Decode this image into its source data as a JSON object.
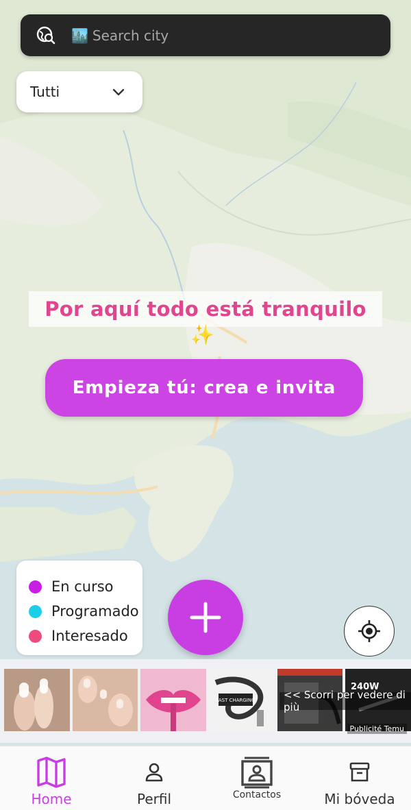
{
  "search": {
    "placeholder": "Search city",
    "globe_icon": "globe-search-icon",
    "city_emoji": "🏙️"
  },
  "filter": {
    "selected": "Tutti",
    "icon": "chevron-down-icon"
  },
  "empty_state": {
    "title": "Por aquí todo está tranquilo",
    "emoji": "✨"
  },
  "cta": {
    "label": "Empieza tú: crea e invita"
  },
  "legend": {
    "items": [
      {
        "label": "En curso",
        "color": "#c81fe6"
      },
      {
        "label": "Programado",
        "color": "#1ccfe8"
      },
      {
        "label": "Interesado",
        "color": "#ee4b7d"
      }
    ]
  },
  "fab": {
    "icon": "plus-icon"
  },
  "locate": {
    "icon": "crosshair-icon"
  },
  "ad": {
    "scroll_hint": "<< Scorri per vedere di più",
    "footer": "Publicité Temu",
    "thumb_texts": [
      "FAST CHARGING",
      "240W"
    ]
  },
  "nav": {
    "items": [
      {
        "label": "Home",
        "icon": "map-icon",
        "active": true
      },
      {
        "label": "Perfil",
        "icon": "person-icon",
        "active": false
      },
      {
        "label": "Contactos",
        "icon": "contacts-icon",
        "active": false
      },
      {
        "label": "Mi bóveda",
        "icon": "archive-box-icon",
        "active": false
      }
    ]
  },
  "colors": {
    "accent": "#c93ee2",
    "title_pink": "#e0468f",
    "search_bg": "#262626"
  }
}
